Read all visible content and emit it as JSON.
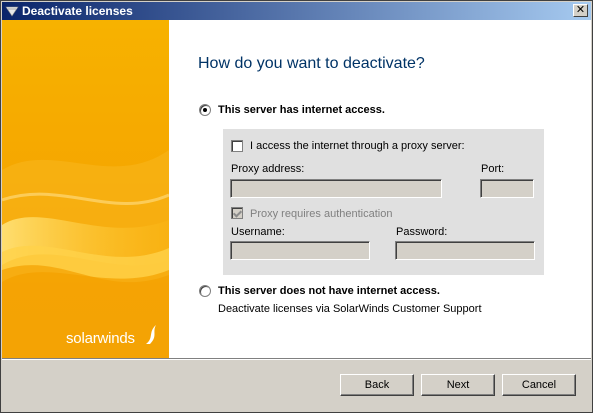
{
  "window": {
    "title": "Deactivate licenses",
    "close_glyph": "✕"
  },
  "banner": {
    "logo_text": "solarwinds",
    "logo_icon": "solarwinds-flame-icon",
    "colors": {
      "primary": "#f5a300",
      "light": "#ffd24a"
    }
  },
  "main": {
    "heading": "How do you want to deactivate?",
    "option_internet": {
      "label": "This server has internet access.",
      "selected": true
    },
    "proxy": {
      "checkbox_label": "I access the internet through a proxy server:",
      "checked": false,
      "address_label": "Proxy address:",
      "address_value": "",
      "port_label": "Port:",
      "port_value": "",
      "auth_label": "Proxy requires authentication",
      "auth_checked": true,
      "username_label": "Username:",
      "username_value": "",
      "password_label": "Password:",
      "password_value": ""
    },
    "option_offline": {
      "label": "This server does not have internet access.",
      "selected": false,
      "description": "Deactivate licenses via SolarWinds Customer Support"
    }
  },
  "footer": {
    "back_label": "Back",
    "next_label": "Next",
    "cancel_label": "Cancel"
  }
}
